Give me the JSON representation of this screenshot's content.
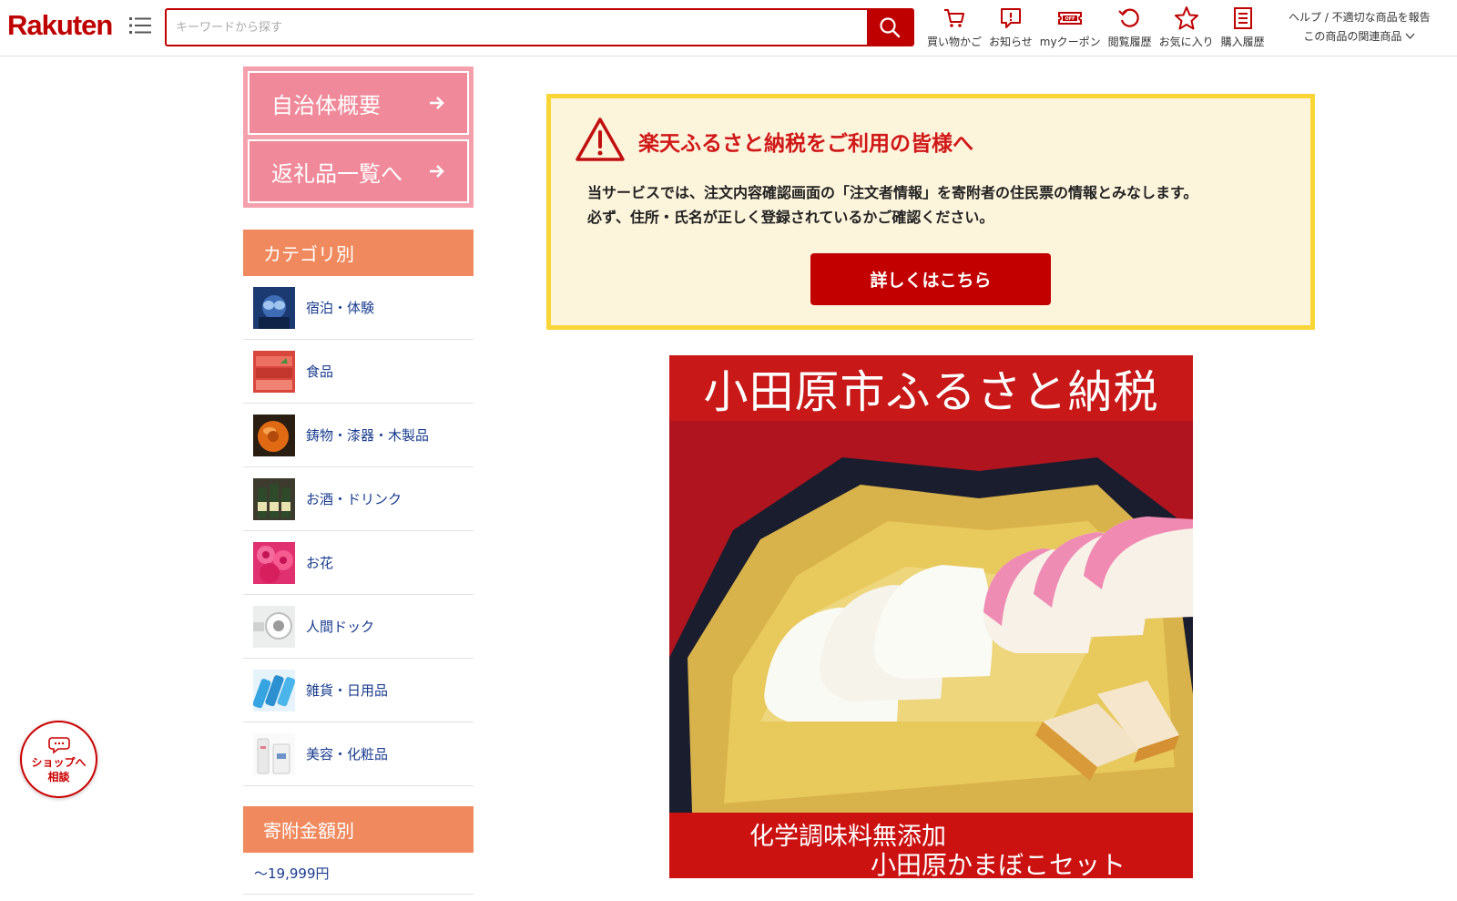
{
  "header": {
    "logo": "Rakuten",
    "search_placeholder": "キーワードから探す",
    "nav": [
      {
        "label": "買い物かご",
        "icon": "cart-icon"
      },
      {
        "label": "お知らせ",
        "icon": "notice-icon"
      },
      {
        "label": "myクーポン",
        "icon": "coupon-icon"
      },
      {
        "label": "閲覧履歴",
        "icon": "history-icon"
      },
      {
        "label": "お気に入り",
        "icon": "star-icon"
      },
      {
        "label": "購入履歴",
        "icon": "purchase-history-icon"
      }
    ],
    "help_text": "ヘルプ / 不適切な商品を報告",
    "related_text": "この商品の関連商品"
  },
  "sidebar": {
    "buttons": [
      {
        "label": "自治体概要"
      },
      {
        "label": "返礼品一覧へ"
      }
    ],
    "category_heading": "カテゴリ別",
    "categories": [
      {
        "label": "宿泊・体験"
      },
      {
        "label": "食品"
      },
      {
        "label": "鋳物・漆器・木製品"
      },
      {
        "label": "お酒・ドリンク"
      },
      {
        "label": "お花"
      },
      {
        "label": "人間ドック"
      },
      {
        "label": "雑貨・日用品"
      },
      {
        "label": "美容・化粧品"
      }
    ],
    "amount_heading": "寄附金額別",
    "amounts": [
      {
        "label": "～19,999円"
      }
    ]
  },
  "notice": {
    "title": "楽天ふるさと納税をご利用の皆様へ",
    "line1": "当サービスでは、注文内容確認画面の「注文者情報」を寄附者の住民票の情報とみなします。",
    "line2": "必ず、住所・氏名が正しく登録されているかご確認ください。",
    "button": "詳しくはこちら"
  },
  "banner": {
    "title": "小田原市ふるさと納税",
    "line1": "化学調味料無添加",
    "line2": "小田原かまぼこセット"
  },
  "shop_chat": {
    "line1": "ショップへ",
    "line2": "相談"
  },
  "colors": {
    "brand": "#bf0000",
    "pink": "#f08a9a",
    "orange": "#f08a5e",
    "notice_bg": "#fdf4dc",
    "notice_border": "#fad538"
  }
}
